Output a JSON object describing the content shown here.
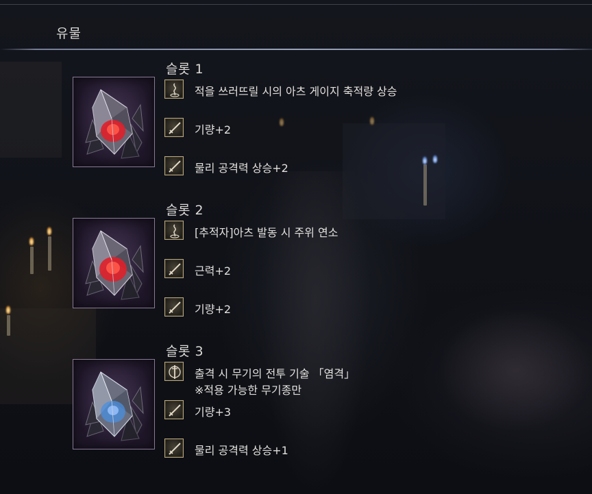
{
  "header": {
    "title": "유물"
  },
  "slots": [
    {
      "title": "슬롯 1",
      "relic": {
        "gem_color": "red",
        "icon": "red-relic-icon"
      },
      "effects": [
        {
          "icon": "arts-icon",
          "text": "적을 쓰러뜨릴 시의 아츠 게이지 축적량 상승"
        },
        {
          "icon": "sword-icon",
          "text": "기량+2"
        },
        {
          "icon": "sword-icon",
          "text": "물리 공격력 상승+2"
        }
      ]
    },
    {
      "title": "슬롯 2",
      "relic": {
        "gem_color": "red",
        "icon": "red-relic-icon"
      },
      "effects": [
        {
          "icon": "arts-icon",
          "text": "[추적자]아츠 발동 시 주위 연소"
        },
        {
          "icon": "sword-icon",
          "text": "근력+2"
        },
        {
          "icon": "sword-icon",
          "text": "기량+2"
        }
      ]
    },
    {
      "title": "슬롯 3",
      "relic": {
        "gem_color": "blue",
        "icon": "blue-relic-icon"
      },
      "effects": [
        {
          "icon": "skill-icon",
          "text": "출격 시 무기의 전투 기술 「염격」",
          "subtext": "※적용 가능한 무기종만"
        },
        {
          "icon": "sword-icon",
          "text": "기량+3"
        },
        {
          "icon": "sword-icon",
          "text": "물리 공격력 상승+1"
        }
      ]
    }
  ],
  "colors": {
    "accent_line": "#aab2cd",
    "text": "#e2e0dc",
    "relic_frame_border": "#8a7a96",
    "icon_border": "#b8a880",
    "gem_red": "#e0202a",
    "gem_blue": "#4a8fe0"
  }
}
